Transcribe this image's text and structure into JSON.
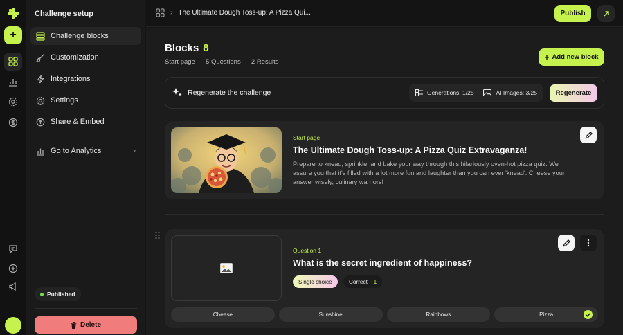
{
  "topbar": {
    "breadcrumb_title": "The Ultimate Dough Toss-up: A Pizza Qui...",
    "publish_label": "Publish"
  },
  "setup": {
    "title": "Challenge setup",
    "nav": [
      {
        "label": "Challenge blocks",
        "icon": "blocks-icon"
      },
      {
        "label": "Customization",
        "icon": "brush-icon"
      },
      {
        "label": "Integrations",
        "icon": "bolt-icon"
      },
      {
        "label": "Settings",
        "icon": "gear-icon"
      },
      {
        "label": "Share & Embed",
        "icon": "share-icon"
      }
    ],
    "analytics_label": "Go to Analytics",
    "status_label": "Published",
    "delete_label": "Delete"
  },
  "main": {
    "heading": "Blocks",
    "block_count": "8",
    "meta": [
      "Start page",
      "·",
      "5 Questions",
      "·",
      "2 Results"
    ],
    "add_block_label": "Add new block",
    "regen": {
      "label": "Regenerate the challenge",
      "generations": "Generations: 1/25",
      "ai_images": "AI Images: 3/25",
      "button": "Regenerate"
    },
    "start_card": {
      "eyebrow": "Start page",
      "title": "The Ultimate Dough Toss-up: A Pizza Quiz Extravaganza!",
      "description": "Prepare to knead, sprinkle, and bake your way through this hilariously oven-hot pizza quiz. We assure you that it's filled with a lot more fun and laughter than you can ever 'knead'. Cheese your answer wisely, culinary warriors!"
    },
    "question_card": {
      "eyebrow": "Question 1",
      "title": "What is the secret ingredient of happiness?",
      "type": "Single choice",
      "correct_label": "Correct",
      "correct_extra": "+1",
      "answers": [
        "Cheese",
        "Sunshine",
        "Rainbows",
        "Pizza"
      ],
      "correct_answer_index": 3
    }
  },
  "colors": {
    "accent": "#c6f24e",
    "danger": "#f07c7c",
    "background": "#1c1c1c"
  }
}
